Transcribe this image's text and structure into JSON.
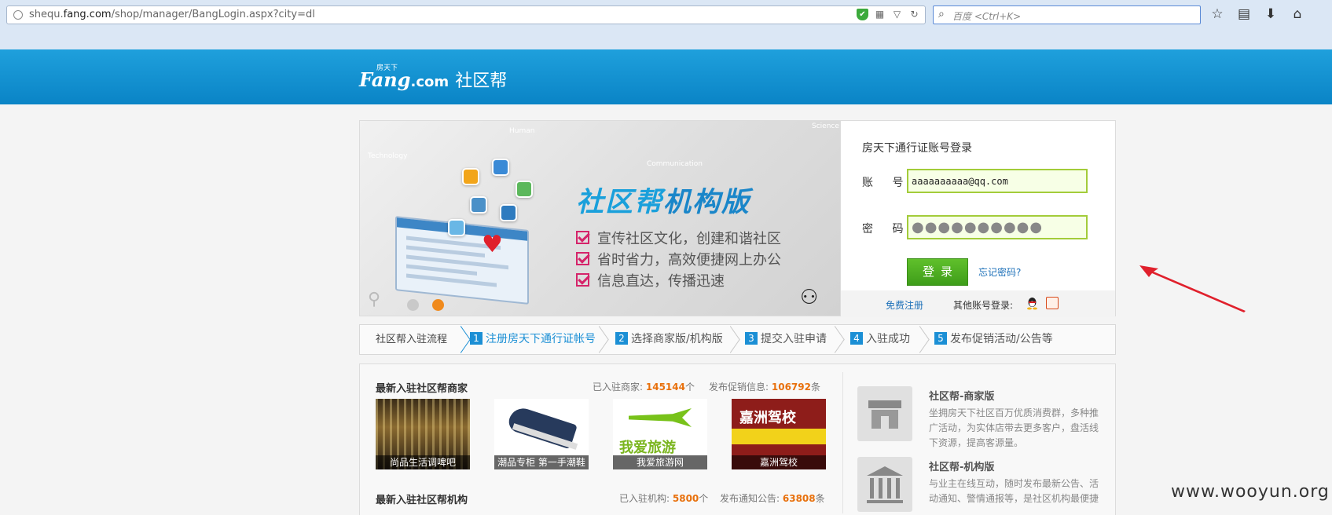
{
  "browser": {
    "url_prefix": "shequ.",
    "url_domain": "fang.com",
    "url_path": "/shop/manager/BangLogin.aspx?city=dl",
    "search_placeholder": "百度 <Ctrl+K>"
  },
  "header": {
    "logo_small": "房天下",
    "logo_fang": "Fang",
    "logo_dotcom": ".com",
    "logo_cn": "社区帮"
  },
  "banner": {
    "bg_words": [
      "Human",
      "Technology",
      "Communication",
      "Science"
    ],
    "title_pre": "社区帮",
    "title_main": "机构版",
    "items": [
      "宣传社区文化，创建和谐社区",
      "省时省力，高效便捷网上办公",
      "信息直达，传播迅速"
    ]
  },
  "login": {
    "title": "房天下通行证账号登录",
    "account_label": "账 号:",
    "account_value": "aaaaaaaaaa@qq.com",
    "password_label": "密 码:",
    "password_value": "●●●●●●●●●●",
    "submit_label": "登录",
    "forgot_label": "忘记密码?",
    "register_label": "免费注册",
    "other_label": "其他账号登录:"
  },
  "steps": {
    "first": "社区帮入驻流程",
    "items": [
      {
        "num": "1",
        "label": "注册房天下通行证帐号"
      },
      {
        "num": "2",
        "label": "选择商家版/机构版"
      },
      {
        "num": "3",
        "label": "提交入驻申请"
      },
      {
        "num": "4",
        "label": "入驻成功"
      },
      {
        "num": "5",
        "label": "发布促销活动/公告等"
      }
    ]
  },
  "merchants": {
    "title": "最新入驻社区帮商家",
    "count_label": "已入驻商家:",
    "count": "145144",
    "count_unit": "个",
    "info_label": "发布促销信息:",
    "info": "106792",
    "info_unit": "条",
    "thumbs": [
      "尚品生活调啤吧",
      "潮品专柜 第一手潮鞋",
      "我爱旅游网",
      "嘉洲驾校"
    ]
  },
  "orgs": {
    "title": "最新入驻社区帮机构",
    "count_label": "已入驻机构:",
    "count": "5800",
    "count_unit": "个",
    "info_label": "发布通知公告:",
    "info": "63808",
    "info_unit": "条"
  },
  "versions": [
    {
      "title": "社区帮-商家版",
      "desc": "坐拥房天下社区百万优质消费群，多种推广活动，为实体店带去更多客户，盘活线下资源，提高客源量。"
    },
    {
      "title": "社区帮-机构版",
      "desc": "与业主在线互动，随时发布最新公告、活动通知、警情通报等，是社区机构最便捷"
    }
  ],
  "thumb_texts": {
    "jiazhou": "嘉洲驾校",
    "woai": "我爱旅游"
  },
  "watermark": "www.wooyun.org",
  "colors": {
    "brand_blue": "#0a84c6",
    "accent_orange": "#e8700c",
    "login_green": "#3e9d1a",
    "arrow_red": "#e0202c"
  }
}
